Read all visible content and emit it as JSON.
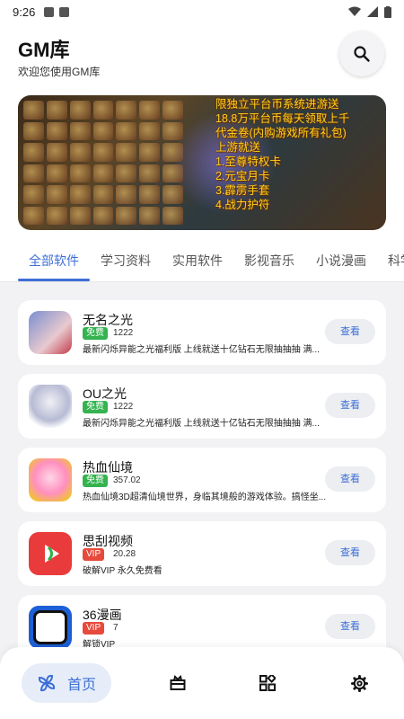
{
  "status_bar": {
    "time": "9:26"
  },
  "header": {
    "title": "GM库",
    "subtitle": "欢迎您使用GM库"
  },
  "banner": {
    "lines": [
      "限独立平台币系统进游送",
      "18.8万平台币每天领取上千",
      "代金卷(内购游戏所有礼包)",
      "上游就送",
      "1.至尊特权卡",
      "2.元宝月卡",
      "3.霹雳手套",
      "4.战力护符"
    ]
  },
  "tabs": [
    "全部软件",
    "学习资料",
    "实用软件",
    "影视音乐",
    "小说漫画",
    "科学"
  ],
  "active_tab": 0,
  "apps": [
    {
      "name": "无名之光",
      "badge": "免费",
      "badge_type": "free",
      "metric": "1222",
      "desc": "最新闪烁异能之光福利版 上线就送十亿钻石无限抽抽抽 满...",
      "button": "查看",
      "icon": "wuming-game-icon",
      "colors": [
        "#7a8fd0",
        "#e8c9cf"
      ]
    },
    {
      "name": "OU之光",
      "badge": "免费",
      "badge_type": "free",
      "metric": "1222",
      "desc": "最新闪烁异能之光福利版 上线就送十亿钻石无限抽抽抽 满...",
      "button": "查看",
      "icon": "ou-game-icon",
      "colors": [
        "#f0f0f5",
        "#8a8fb0"
      ]
    },
    {
      "name": "热血仙境",
      "badge": "免费",
      "badge_type": "free",
      "metric": "357.02",
      "desc": "热血仙境3D超清仙境世界，身临其境般的游戏体验。搞怪坐...",
      "button": "查看",
      "icon": "rexue-game-icon",
      "colors": [
        "#ff9ec8",
        "#f2c234"
      ]
    },
    {
      "name": "思刮视频",
      "badge": "VIP",
      "badge_type": "vip",
      "metric": "20.28",
      "desc": "破解VIP 永久免费看",
      "button": "查看",
      "icon": "video-app-icon",
      "colors": [
        "#e93b3b",
        "#2fb14a"
      ]
    },
    {
      "name": "36漫画",
      "badge": "VIP",
      "badge_type": "vip",
      "metric": "7",
      "desc": "解锁VIP",
      "button": "查看",
      "icon": "comic-app-icon",
      "colors": [
        "#1d5fd6",
        "#ffffff"
      ]
    }
  ],
  "bottom_nav": {
    "home_label": "首页"
  },
  "colors": {
    "accent": "#3d6fd6",
    "free": "#34b34f",
    "vip": "#e74a3c"
  }
}
